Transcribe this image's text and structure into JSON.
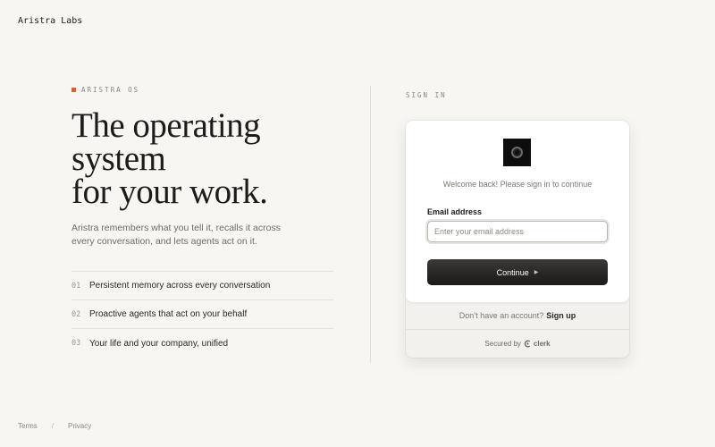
{
  "brand": "Aristra Labs",
  "hero": {
    "eyebrow": "ARISTRA OS",
    "headline": [
      "The operating",
      "system",
      "for your work."
    ],
    "description": "Aristra remembers what you tell it, recalls it across every conversation, and lets agents act on it."
  },
  "features": [
    {
      "num": "01",
      "text": "Persistent memory across every conversation"
    },
    {
      "num": "02",
      "text": "Proactive agents that act on your behalf"
    },
    {
      "num": "03",
      "text": "Your life and your company, unified"
    }
  ],
  "signin": {
    "label": "SIGN IN",
    "welcome": "Welcome back! Please sign in to continue",
    "email_label": "Email address",
    "email_placeholder": "Enter your email address",
    "email_value": "",
    "continue_label": "Continue",
    "no_account": "Don’t have an account?",
    "signup_label": "Sign up",
    "secured_by": "Secured by",
    "provider": "clerk"
  },
  "footer": {
    "terms": "Terms",
    "separator": "/",
    "privacy": "Privacy"
  },
  "colors": {
    "accent": "#d9622b",
    "background": "#f7f6f3",
    "button": "#1b1a19"
  }
}
